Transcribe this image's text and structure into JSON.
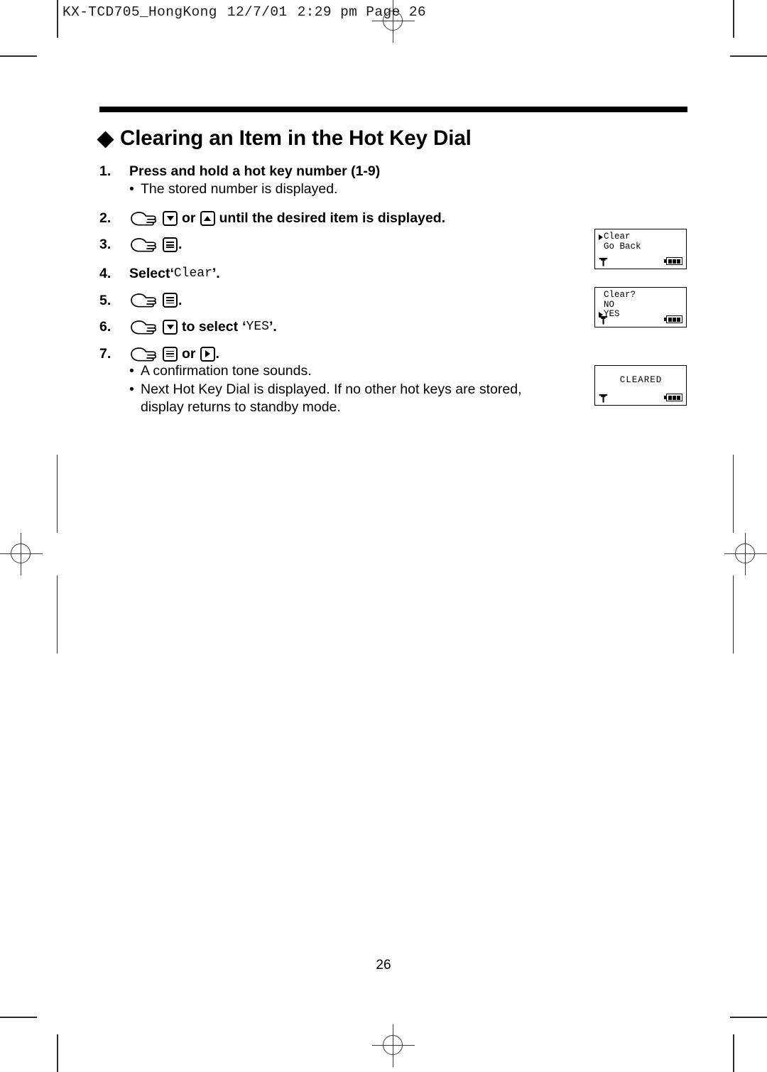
{
  "print_marks": {
    "header_line": {
      "model": "KX-TCD705_HongKong",
      "date": "12/7/01",
      "time": "2:29 pm",
      "page_label": "Page",
      "page_number": "26"
    }
  },
  "page": {
    "title": "Clearing an Item in the Hot Key Dial",
    "title_bullet_icon": "diamond-bullet-icon",
    "page_number": "26"
  },
  "steps": [
    {
      "number": "1.",
      "text": "Press and hold a hot key number (1-9)",
      "notes": [
        "The stored number is displayed."
      ]
    },
    {
      "number": "2.",
      "icons": [
        "hand-pointer-icon",
        "arrow-down-key-icon",
        "arrow-up-key-icon"
      ],
      "or_word": "or",
      "text_after": "until the desired item is displayed."
    },
    {
      "number": "3.",
      "icons": [
        "hand-pointer-icon",
        "menu-key-icon"
      ],
      "text_after": "."
    },
    {
      "number": "4.",
      "label": "Select",
      "quote_open": "‘",
      "mono_value": "Clear",
      "quote_close": "’."
    },
    {
      "number": "5.",
      "icons": [
        "hand-pointer-icon",
        "menu-key-icon"
      ],
      "text_after": "."
    },
    {
      "number": "6.",
      "icons": [
        "hand-pointer-icon",
        "arrow-down-key-icon"
      ],
      "text_mid": "to select",
      "quote_open": "‘",
      "mono_value": "YES",
      "quote_close": "’."
    },
    {
      "number": "7.",
      "icons": [
        "hand-pointer-icon",
        "menu-key-icon",
        "arrow-right-key-icon"
      ],
      "or_word": "or",
      "text_after": ".",
      "notes": [
        "A confirmation tone sounds.",
        "Next Hot Key Dial is displayed. If no other hot keys are stored, display returns to standby mode."
      ]
    }
  ],
  "bullet_char": "•",
  "displays": [
    {
      "name": "lcd-clear-go-back",
      "lines": [
        {
          "caret": true,
          "text": "Clear"
        },
        {
          "caret": false,
          "text": "Go Back"
        }
      ],
      "status": {
        "antenna": "antenna-icon",
        "battery": "battery-full-icon",
        "battery_bars": 3
      }
    },
    {
      "name": "lcd-clear-confirm",
      "lines": [
        {
          "caret": false,
          "text": "Clear?"
        },
        {
          "caret": false,
          "text": "NO"
        },
        {
          "caret": true,
          "text": "YES"
        }
      ],
      "status": {
        "antenna": "antenna-icon",
        "battery": "battery-full-icon",
        "battery_bars": 3
      }
    },
    {
      "name": "lcd-cleared",
      "centered_text": "CLEARED",
      "status": {
        "antenna": "antenna-icon",
        "battery": "battery-full-icon",
        "battery_bars": 3
      }
    }
  ],
  "colors": {
    "ink": "#000000",
    "mark": "#3a3a3a",
    "paper": "#ffffff"
  }
}
